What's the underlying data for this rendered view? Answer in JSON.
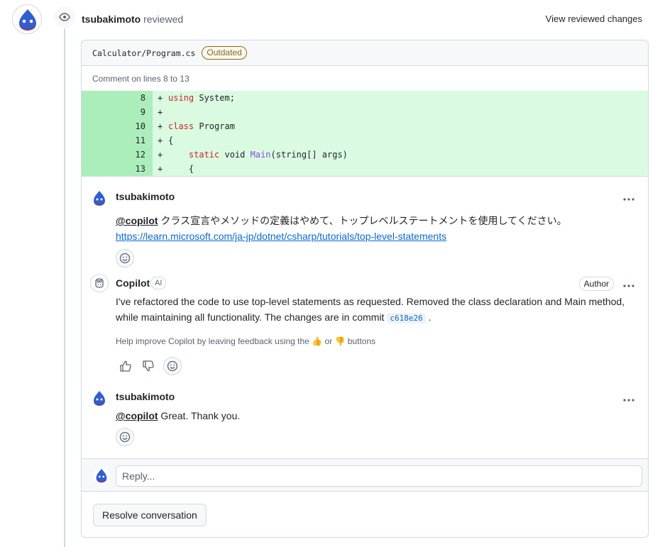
{
  "review": {
    "reviewer": "tsubakimoto",
    "verb": "reviewed",
    "view_changes_label": "View reviewed changes"
  },
  "file": {
    "path": "Calculator/Program.cs",
    "badge": "Outdated",
    "comment_on": "Comment on lines 8 to 13"
  },
  "code_lines": [
    {
      "num": "8",
      "sign": "+",
      "parts": [
        {
          "t": "kw",
          "v": "using"
        },
        {
          "t": "",
          "v": " System;"
        }
      ]
    },
    {
      "num": "9",
      "sign": "+",
      "parts": []
    },
    {
      "num": "10",
      "sign": "+",
      "parts": [
        {
          "t": "kw",
          "v": "class"
        },
        {
          "t": "",
          "v": " Program"
        }
      ]
    },
    {
      "num": "11",
      "sign": "+",
      "parts": [
        {
          "t": "",
          "v": "{"
        }
      ]
    },
    {
      "num": "12",
      "sign": "+",
      "parts": [
        {
          "t": "",
          "v": "    "
        },
        {
          "t": "kw",
          "v": "static"
        },
        {
          "t": "",
          "v": " void "
        },
        {
          "t": "fn",
          "v": "Main"
        },
        {
          "t": "",
          "v": "(string[] args)"
        }
      ]
    },
    {
      "num": "13",
      "sign": "+",
      "parts": [
        {
          "t": "",
          "v": "    {"
        }
      ]
    }
  ],
  "comments": [
    {
      "author": "tsubakimoto",
      "mention": "@copilot",
      "text": " クラス宣言やメソッドの定義はやめて、トップレベルステートメントを使用してください。",
      "link": "https://learn.microsoft.com/ja-jp/dotnet/csharp/tutorials/top-level-statements"
    },
    {
      "author": "Copilot",
      "ai_badge": "AI",
      "role_badge": "Author",
      "text_before": "I've refactored the code to use top-level statements as requested. Removed the class declaration and Main method, while maintaining all functionality. The changes are in commit ",
      "commit": "c618e26",
      "text_after": " .",
      "feedback_before": "Help improve Copilot by leaving feedback using the ",
      "feedback_or": " or ",
      "feedback_after": " buttons"
    },
    {
      "author": "tsubakimoto",
      "mention": "@copilot",
      "text": " Great. Thank you."
    }
  ],
  "reply": {
    "placeholder": "Reply..."
  },
  "resolve_label": "Resolve conversation",
  "colors": {
    "code_added_bg": "#dafbe1",
    "gutter_added_bg": "#aceebb",
    "keyword": "#cf222e",
    "function": "#8250df",
    "link": "#0969da",
    "outdated": "#9a6700"
  },
  "icons": {
    "eye": "eye-icon",
    "smiley": "smiley-icon",
    "thumbs_up": "thumbs-up-icon",
    "thumbs_down": "thumbs-down-icon",
    "copilot": "copilot-icon",
    "kebab": "kebab-horizontal-icon"
  }
}
